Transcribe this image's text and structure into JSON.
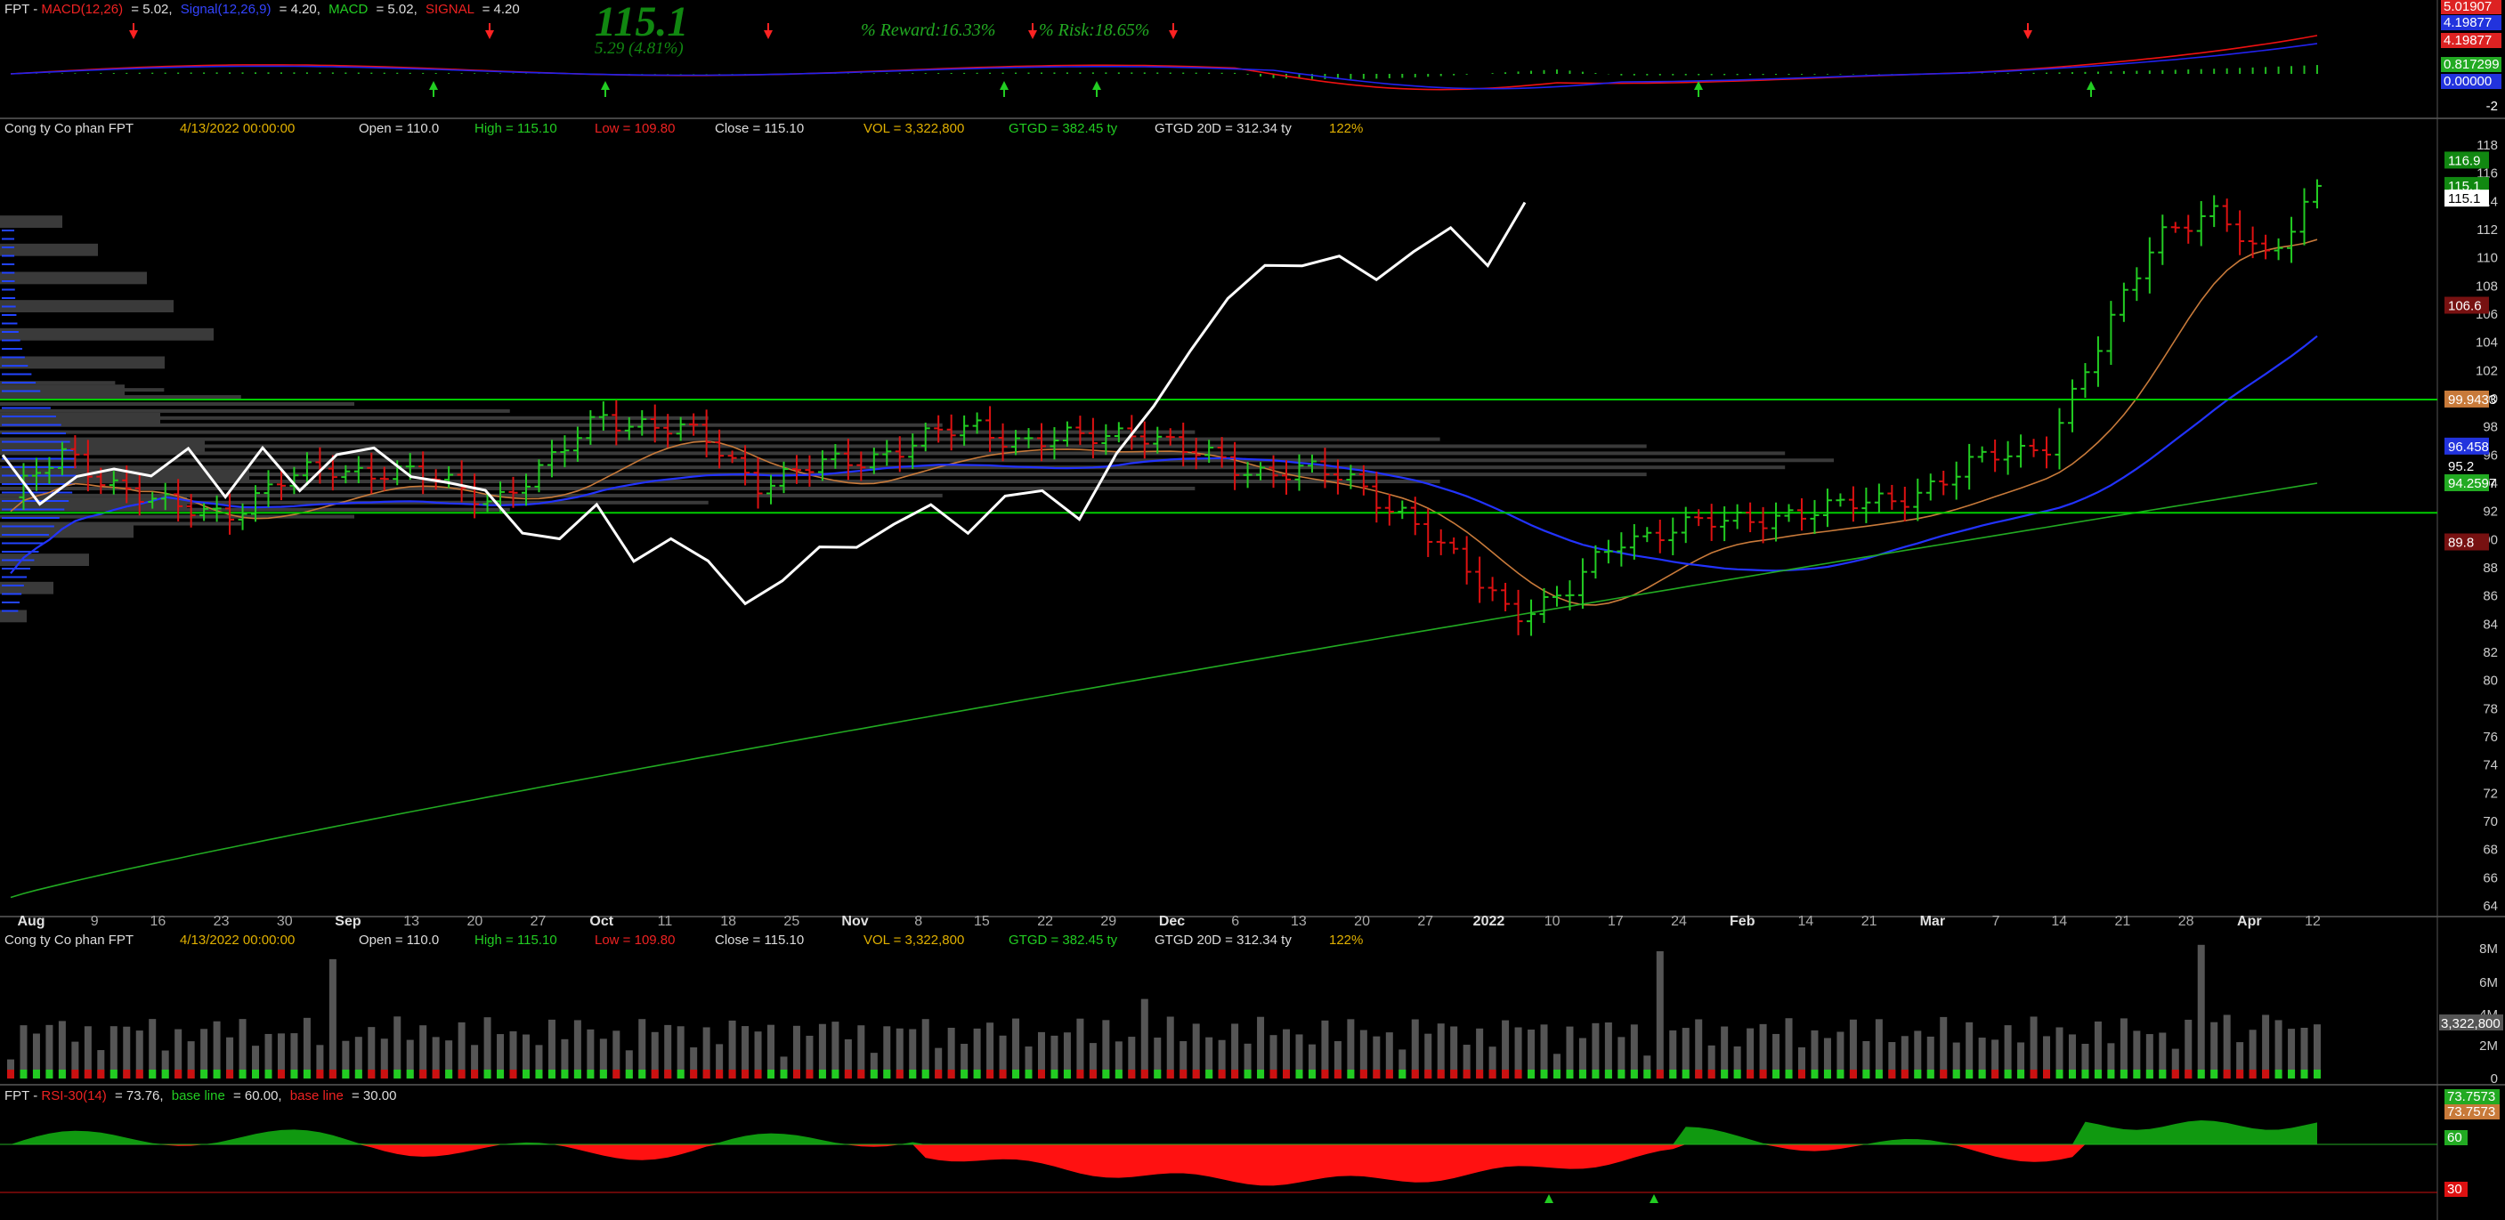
{
  "colors": {
    "background": "#000000",
    "up": "#22cc22",
    "down": "#dd1111",
    "close_line": "#ffffff",
    "macd": "#ee1111",
    "signal": "#2222ee",
    "level_line": "#00cc00",
    "volume_profile": "#3a3a3a",
    "volume_profile_left": "#2244ff",
    "ma_short": "#c87a3a",
    "ma_mid": "#2233ff",
    "ma_long": "#22aa22",
    "rsi_above": "#109910",
    "rsi_below": "#ff1111"
  },
  "macd_panel": {
    "header": {
      "symbol": "FPT",
      "macd_label": "MACD(12,26)",
      "macd_value": "= 5.02,",
      "signal_label": "Signal(12,26,9)",
      "signal_value": "= 4.20,",
      "macd2_label": "MACD",
      "macd2_value": "= 5.02,",
      "signal2_label": "SIGNAL",
      "signal2_value": "= 4.20"
    },
    "big_price": "115.1",
    "big_change": "5.29 (4.81%)",
    "reward": "% Reward:16.33%",
    "risk": "% Risk:18.65%",
    "axis_labels": [
      {
        "text": "5.01907",
        "bg": "#dd2222"
      },
      {
        "text": "4.19877",
        "bg": "#2233dd"
      },
      {
        "text": "4.19877",
        "bg": "#dd2222"
      },
      {
        "text": "0.817299",
        "bg": "#22aa22"
      },
      {
        "text": "0.00000",
        "bg": "#2233dd"
      },
      {
        "text": "-2",
        "bg": "none"
      }
    ]
  },
  "price_panel": {
    "header": {
      "name": "Cong ty Co phan FPT",
      "date": "4/13/2022 00:00:00",
      "open": "Open = 110.0",
      "high": "High = 115.10",
      "low": "Low = 109.80",
      "close": "Close = 115.10",
      "vol": "VOL = 3,322,800",
      "gtgd": "GTGD = 382.45  ty",
      "gtgd20": "GTGD 20D = 312.34  ty",
      "pct": "122%"
    },
    "y_ticks": [
      "118",
      "116",
      "114",
      "112",
      "110",
      "108",
      "106",
      "104",
      "102",
      "100",
      "98",
      "96",
      "94",
      "92",
      "90",
      "88",
      "86",
      "84",
      "82",
      "80",
      "78",
      "76",
      "74",
      "72",
      "70",
      "68",
      "66",
      "64"
    ],
    "value_labels": [
      {
        "text": "116.9",
        "value": 116.9,
        "bg": "#118811"
      },
      {
        "text": "115.1",
        "value": 115.1,
        "bg": "#118811"
      },
      {
        "text": "115.1",
        "value": 114.2,
        "bg": "#ffffff"
      },
      {
        "text": "106.6",
        "value": 106.6,
        "bg": "#771111"
      },
      {
        "text": "99.9433",
        "value": 99.94,
        "bg": "#c87a3a"
      },
      {
        "text": "96.458",
        "value": 96.6,
        "bg": "#2233dd"
      },
      {
        "text": "95.2",
        "value": 95.2,
        "bg": "none"
      },
      {
        "text": "94.2597",
        "value": 94.0,
        "bg": "#22aa22"
      },
      {
        "text": "89.8",
        "value": 89.8,
        "bg": "#771111"
      }
    ],
    "x_labels": [
      "Aug",
      "9",
      "16",
      "23",
      "30",
      "Sep",
      "13",
      "20",
      "27",
      "Oct",
      "11",
      "18",
      "25",
      "Nov",
      "8",
      "15",
      "22",
      "29",
      "Dec",
      "6",
      "13",
      "20",
      "27",
      "2022",
      "10",
      "17",
      "24",
      "Feb",
      "14",
      "21",
      "Mar",
      "7",
      "14",
      "21",
      "28",
      "Apr",
      "12"
    ],
    "month_labels": [
      "Aug",
      "Sep",
      "Oct",
      "Nov",
      "Dec",
      "2022",
      "Feb",
      "Mar",
      "Apr"
    ]
  },
  "volume_panel": {
    "header": {
      "name": "Cong ty Co phan FPT",
      "date": "4/13/2022 00:00:00",
      "open": "Open = 110.0",
      "high": "High = 115.10",
      "low": "Low = 109.80",
      "close": "Close = 115.10",
      "vol": "VOL = 3,322,800",
      "gtgd": "GTGD = 382.45  ty",
      "gtgd20": "GTGD 20D = 312.34  ty",
      "pct": "122%"
    },
    "y_ticks": [
      "8M",
      "6M",
      "4M",
      "2M",
      "0"
    ],
    "last_label": "3,322,800"
  },
  "rsi_panel": {
    "header": {
      "symbol": "FPT",
      "rsi_label": "RSI-30(14)",
      "rsi_value": "= 73.76,",
      "base1_label": "base line",
      "base1_value": "= 60.00,",
      "base2_label": "base line",
      "base2_value": "= 30.00"
    },
    "labels": [
      {
        "text": "73.7573",
        "bg": "#22aa22"
      },
      {
        "text": "73.7573",
        "bg": "#c87a3a"
      },
      {
        "text": "60",
        "bg": "#22aa22"
      },
      {
        "text": "30",
        "bg": "#dd1111"
      }
    ]
  },
  "chart_data": {
    "type": "ohlc",
    "symbol": "FPT",
    "title": "Cong ty Co phan FPT",
    "dates_range": [
      "2021-07-26",
      "2022-04-13"
    ],
    "price_ylim": [
      63,
      119
    ],
    "horizontal_levels": [
      99.94,
      91.9
    ],
    "last": {
      "open": 110.0,
      "high": 115.1,
      "low": 109.8,
      "close": 115.1,
      "volume": 3322800
    },
    "close_weekly_approx": [
      93,
      96,
      94,
      92,
      92,
      94,
      95,
      95,
      94,
      93,
      95,
      99,
      98,
      97,
      94,
      95,
      96,
      97,
      98,
      97,
      97,
      98,
      96,
      95,
      95,
      94,
      92,
      88,
      85,
      86,
      90,
      91,
      91,
      92,
      92,
      93,
      94,
      96,
      97,
      104,
      112,
      113,
      110,
      115.1
    ],
    "rsi": {
      "value": 73.76,
      "baselines": [
        60,
        30
      ]
    },
    "macd": {
      "macd": 5.02,
      "signal": 4.2
    }
  }
}
